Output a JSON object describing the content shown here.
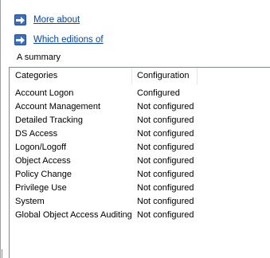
{
  "links": [
    {
      "label": "More about",
      "icon": "arrow-right-icon"
    },
    {
      "label": "Which editions of",
      "icon": "arrow-right-icon"
    }
  ],
  "summary_label": "A summary",
  "table": {
    "columns": [
      "Categories",
      "Configuration"
    ],
    "rows": [
      {
        "category": "Account Logon",
        "configuration": "Configured"
      },
      {
        "category": "Account Management",
        "configuration": "Not configured"
      },
      {
        "category": "Detailed Tracking",
        "configuration": "Not configured"
      },
      {
        "category": "DS Access",
        "configuration": "Not configured"
      },
      {
        "category": "Logon/Logoff",
        "configuration": "Not configured"
      },
      {
        "category": "Object Access",
        "configuration": "Not configured"
      },
      {
        "category": "Policy Change",
        "configuration": "Not configured"
      },
      {
        "category": "Privilege Use",
        "configuration": "Not configured"
      },
      {
        "category": "System",
        "configuration": "Not configured"
      },
      {
        "category": "Global Object Access Auditing",
        "configuration": "Not configured"
      }
    ]
  },
  "colors": {
    "link": "#0645ad",
    "icon_bg": "#3a6fc4",
    "border": "#828790"
  }
}
